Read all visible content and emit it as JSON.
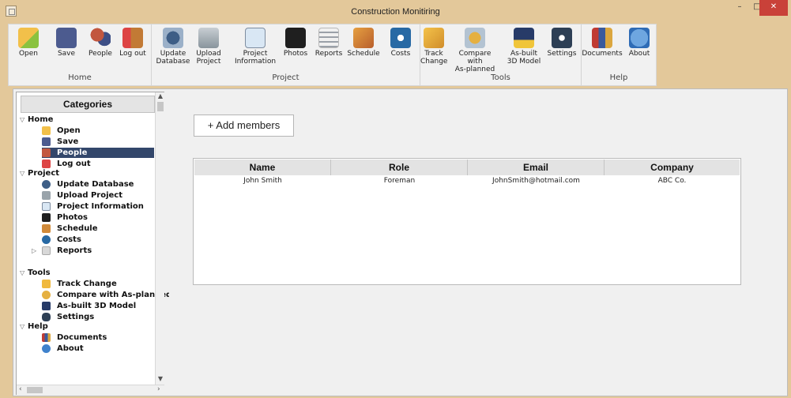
{
  "window": {
    "title": "Construction Monitiring"
  },
  "window_controls": {
    "minimize": "–",
    "maximize": "□",
    "close": "✕"
  },
  "ribbon": {
    "groups": [
      {
        "label": "Home",
        "buttons": [
          "Open",
          "Save",
          "People",
          "Log out"
        ]
      },
      {
        "label": "Project",
        "buttons": [
          "Update\nDatabase",
          "Upload\nProject",
          "Project\nInformation",
          "Photos",
          "Reports",
          "Schedule",
          "Costs"
        ]
      },
      {
        "label": "Tools",
        "buttons": [
          "Track\nChange",
          "Compare with\nAs-planned",
          "As-built\n3D Model",
          "Settings"
        ]
      },
      {
        "label": "Help",
        "buttons": [
          "Documents",
          "About"
        ]
      }
    ]
  },
  "sidebar": {
    "header": "Categories",
    "sections": [
      {
        "label": "Home",
        "items": [
          "Open",
          "Save",
          "People",
          "Log out"
        ]
      },
      {
        "label": "Project",
        "items": [
          "Update Database",
          "Upload Project",
          "Project Information",
          "Photos",
          "Schedule",
          "Costs",
          "Reports"
        ]
      },
      {
        "label": "Tools",
        "items": [
          "Track Change",
          "Compare with As-planned",
          "As-built 3D Model",
          "Settings"
        ]
      },
      {
        "label": "Help",
        "items": [
          "Documents",
          "About"
        ]
      }
    ],
    "selected": "People"
  },
  "content": {
    "add_button": "+ Add members",
    "table": {
      "columns": [
        "Name",
        "Role",
        "Email",
        "Company"
      ],
      "rows": [
        [
          "John Smith",
          "Foreman",
          "JohnSmith@hotmail.com",
          "ABC Co."
        ]
      ]
    }
  },
  "colors": {
    "titlebar": "#e3c89a",
    "selected_item": "#33476b",
    "close_button": "#c94139"
  }
}
